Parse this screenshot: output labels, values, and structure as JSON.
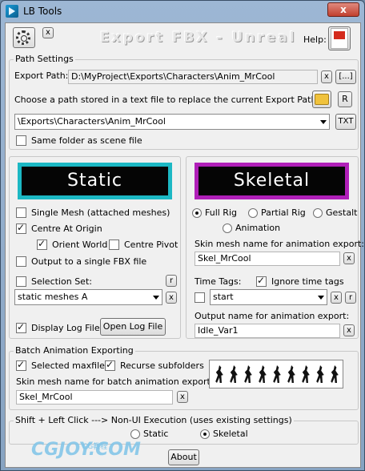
{
  "window": {
    "title": "LB Tools",
    "close_label": "x"
  },
  "header": {
    "gear_close_label": "x",
    "banner_title": "Export FBX - Unreal",
    "help_label": "Help:"
  },
  "path_settings": {
    "group_title": "Path Settings",
    "export_path_label": "Export Path:",
    "export_path_value": "D:\\MyProject\\Exports\\Characters\\Anim_MrCool",
    "clear_label": "x",
    "browse_label": "[...]",
    "choose_text": "Choose a path stored in a text file to replace the current Export Path...",
    "r_label": "R",
    "stored_path_value": "\\Exports\\Characters\\Anim_MrCool",
    "txt_label": "TXT",
    "same_folder_label": "Same folder as scene file",
    "same_folder_checked": false
  },
  "static_panel": {
    "banner": "Static",
    "banner_color": "#1cb8c4",
    "single_mesh_label": "Single Mesh (attached meshes)",
    "single_mesh_checked": false,
    "centre_origin_label": "Centre At Origin",
    "centre_origin_checked": true,
    "orient_world_label": "Orient World",
    "orient_world_checked": true,
    "centre_pivot_label": "Centre Pivot",
    "centre_pivot_checked": false,
    "single_fbx_label": "Output to a single FBX file",
    "single_fbx_checked": false,
    "selection_set_label": "Selection Set:",
    "selection_set_checked": false,
    "r_label": "r",
    "selection_set_value": "static meshes A",
    "x_label": "x",
    "display_log_label": "Display Log File",
    "display_log_checked": true,
    "open_log_label": "Open Log File"
  },
  "skeletal_panel": {
    "banner": "Skeletal",
    "banner_color": "#b01fb8",
    "full_rig_label": "Full Rig",
    "partial_rig_label": "Partial Rig",
    "gestalt_label": "Gestalt",
    "animation_label": "Animation",
    "selected_mode": "Full Rig",
    "skin_mesh_label": "Skin mesh name for animation export:",
    "skin_mesh_value": "Skel_MrCool",
    "x_label": "x",
    "time_tags_label": "Time Tags:",
    "ignore_time_tags_label": "Ignore time tags",
    "ignore_time_tags_checked": true,
    "time_tag_checked": false,
    "time_tag_value": "start",
    "r_label": "r",
    "output_name_label": "Output name for animation export:",
    "output_name_value": "Idle_Var1"
  },
  "batch": {
    "group_title": "Batch Animation Exporting",
    "selected_maxfiles_label": "Selected maxfiles",
    "selected_maxfiles_checked": true,
    "recurse_label": "Recurse subfolders",
    "recurse_checked": true,
    "skin_mesh_label": "Skin mesh name for batch animation export:",
    "skin_mesh_value": "Skel_MrCool",
    "x_label": "x"
  },
  "execution": {
    "group_title": "Shift + Left Click ---> Non-UI Execution (uses existing settings)",
    "static_label": "Static",
    "skeletal_label": "Skeletal",
    "selected": "Skeletal"
  },
  "footer": {
    "about_label": "About",
    "watermark": "CGJOY.COM",
    "watermark_small": "CG教程"
  }
}
